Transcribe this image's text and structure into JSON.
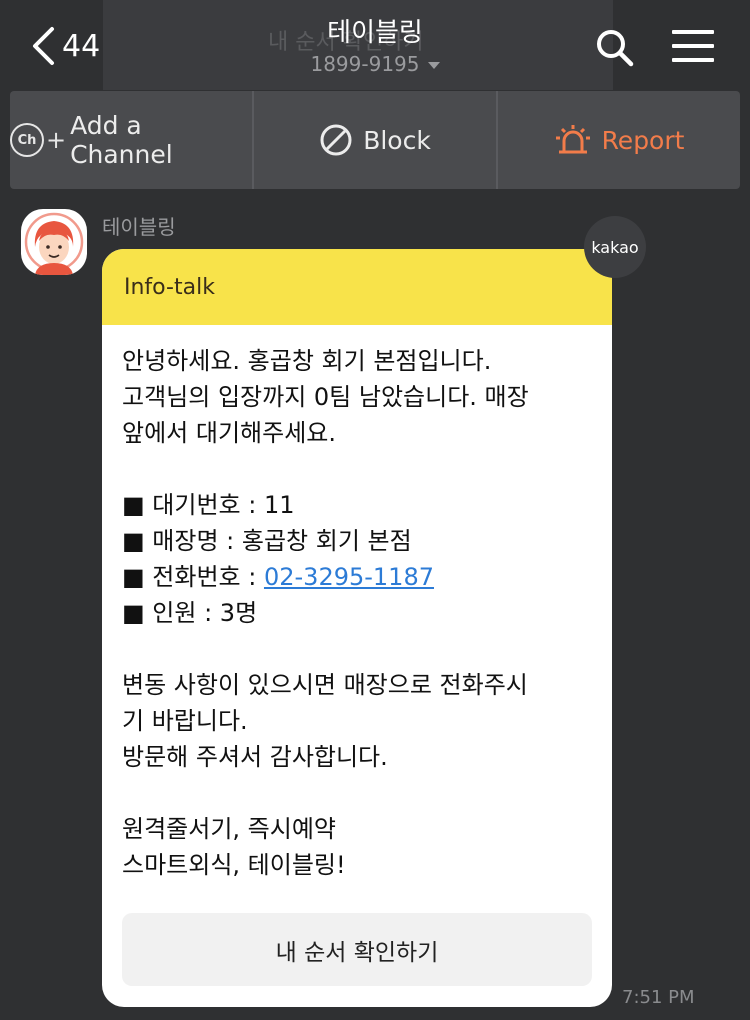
{
  "overlay": {
    "text": "내 순서 확인하기"
  },
  "header": {
    "back_count": "44",
    "title": "테이블링",
    "subtitle": "1899-9195"
  },
  "actions": {
    "add_channel": {
      "ch_label": "Ch",
      "plus": "+",
      "label": "Add a Channel"
    },
    "block": {
      "label": "Block"
    },
    "report": {
      "label": "Report",
      "color": "#f27c4a"
    }
  },
  "message": {
    "sender": "테이블링",
    "badge": "kakao",
    "header_label": "Info-talk",
    "header_color": "#f8e34a",
    "greeting": [
      "안녕하세요. 홍곱창 회기 본점입니다.",
      "고객님의 입장까지 0팀 남았습니다. 매장",
      "앞에서 대기해주세요."
    ],
    "details": {
      "wait_no": "■ 대기번호 : 11",
      "store": "■ 매장명 : 홍곱창 회기 본점",
      "phone_label": "■ 전화번호 : ",
      "phone_number": "02-3295-1187",
      "people": "■ 인원 : 3명"
    },
    "notice": [
      "변동 사항이 있으시면 매장으로 전화주시",
      "기 바랍니다.",
      "방문해 주셔서 감사합니다."
    ],
    "slogan": [
      "원격줄서기, 즉시예약",
      "스마트외식, 테이블링!"
    ],
    "button_label": "내 순서 확인하기",
    "time": "7:51 PM"
  }
}
